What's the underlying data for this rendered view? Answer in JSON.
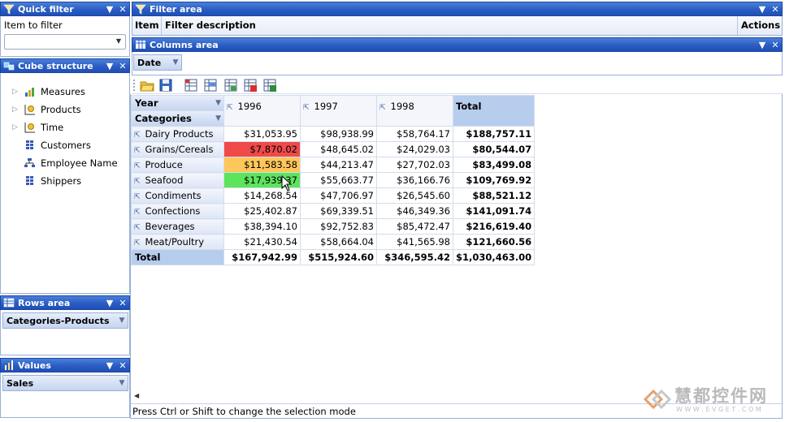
{
  "quick_filter": {
    "title": "Quick filter",
    "label": "Item to filter",
    "value": ""
  },
  "cube_structure": {
    "title": "Cube structure",
    "items": [
      {
        "label": "Measures",
        "icon": "measures-icon",
        "expandable": true
      },
      {
        "label": "Products",
        "icon": "dimension-icon",
        "expandable": true
      },
      {
        "label": "Time",
        "icon": "dimension-icon",
        "expandable": true
      },
      {
        "label": "Customers",
        "icon": "hierarchy-icon",
        "expandable": false
      },
      {
        "label": "Employee Name",
        "icon": "parent-child-icon",
        "expandable": false
      },
      {
        "label": "Shippers",
        "icon": "hierarchy-icon",
        "expandable": false
      }
    ]
  },
  "rows_area": {
    "title": "Rows area",
    "field": "Categories-Products"
  },
  "values_area": {
    "title": "Values",
    "field": "Sales"
  },
  "filter_area": {
    "title": "Filter area",
    "col_item": "Item",
    "col_desc": "Filter description",
    "col_actions": "Actions"
  },
  "columns_area": {
    "title": "Columns area",
    "field": "Date"
  },
  "toolbar": [
    "open-icon",
    "save-icon",
    "grid-export-1-icon",
    "grid-export-2-icon",
    "grid-export-3-icon",
    "pdf-export-icon",
    "excel-export-icon"
  ],
  "grid": {
    "year_label": "Year",
    "categories_label": "Categories",
    "columns": [
      "1996",
      "1997",
      "1998"
    ],
    "total_label": "Total",
    "rows": [
      {
        "name": "Dairy Products",
        "v": [
          "$31,053.95",
          "$98,938.99",
          "$58,764.17"
        ],
        "total": "$188,757.11",
        "hl": ""
      },
      {
        "name": "Grains/Cereals",
        "v": [
          "$7,870.02",
          "$48,645.02",
          "$24,029.03"
        ],
        "total": "$80,544.07",
        "hl": "#ee4a4a"
      },
      {
        "name": "Produce",
        "v": [
          "$11,583.58",
          "$44,213.47",
          "$27,702.03"
        ],
        "total": "$83,499.08",
        "hl": "#ffc65a"
      },
      {
        "name": "Seafood",
        "v": [
          "$17,939.37",
          "$55,663.77",
          "$36,166.76"
        ],
        "total": "$109,769.92",
        "hl": "#5de45d"
      },
      {
        "name": "Condiments",
        "v": [
          "$14,268.54",
          "$47,706.97",
          "$26,545.60"
        ],
        "total": "$88,521.12",
        "hl": ""
      },
      {
        "name": "Confections",
        "v": [
          "$25,402.87",
          "$69,339.51",
          "$46,349.36"
        ],
        "total": "$141,091.74",
        "hl": ""
      },
      {
        "name": "Beverages",
        "v": [
          "$38,394.10",
          "$92,752.83",
          "$85,472.47"
        ],
        "total": "$216,619.40",
        "hl": ""
      },
      {
        "name": "Meat/Poultry",
        "v": [
          "$21,430.54",
          "$58,664.04",
          "$41,565.98"
        ],
        "total": "$121,660.56",
        "hl": ""
      }
    ],
    "totals": [
      "$167,942.99",
      "$515,924.60",
      "$346,595.42",
      "$1,030,463.00"
    ]
  },
  "status": {
    "text": "Press Ctrl or Shift to change the selection mode"
  },
  "watermark": {
    "cn": "慧都控件网",
    "url": "W W W . E V G E T . C O M"
  }
}
